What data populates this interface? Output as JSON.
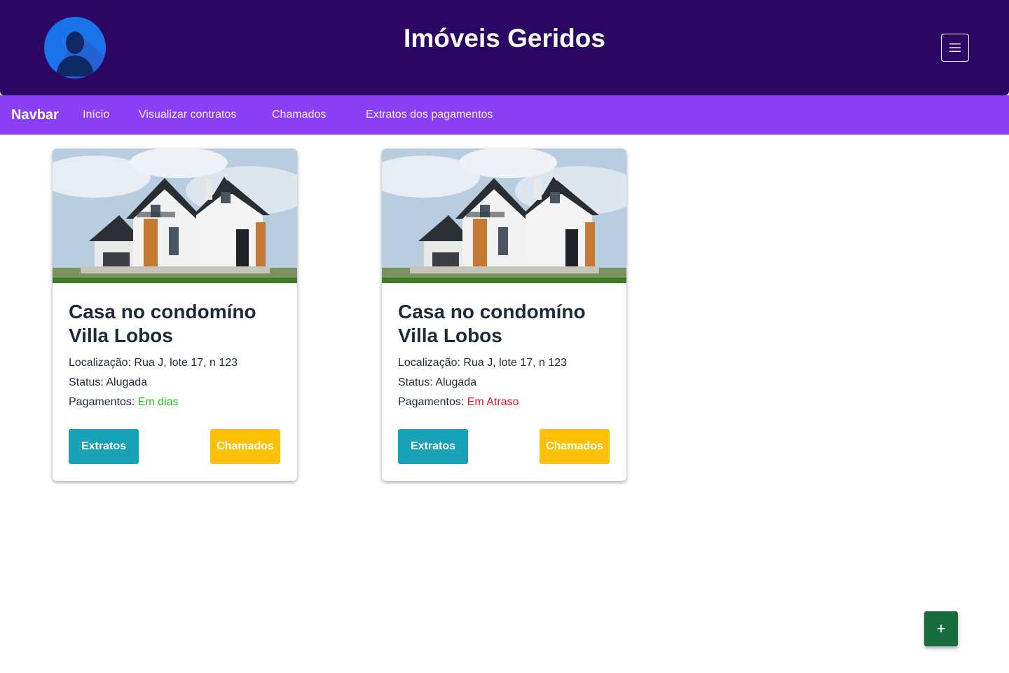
{
  "header": {
    "title": "Imóveis Geridos",
    "avatar_icon": "user-avatar-icon",
    "menu_icon": "hamburger-icon"
  },
  "navbar": {
    "brand": "Navbar",
    "links": [
      "Início",
      "Visualizar contratos",
      "Chamados",
      "Extratos dos pagamentos"
    ]
  },
  "cards": [
    {
      "title": "Casa no condomíno Villa Lobos",
      "location_label": "Localização:",
      "location": "Rua J, lote 17, n 123",
      "status_label": "Status:",
      "status": "Alugada",
      "payments_label": "Pagamentos:",
      "payments": "Em dias",
      "payments_color": "#22c41a",
      "btn_extratos": "Extratos",
      "btn_chamados": "Chamados"
    },
    {
      "title": "Casa no condomíno Villa Lobos",
      "location_label": "Localização:",
      "location": "Rua J, lote 17, n 123",
      "status_label": "Status:",
      "status": "Alugada",
      "payments_label": "Pagamentos:",
      "payments": "Em Atraso",
      "payments_color": "#e8141c",
      "btn_extratos": "Extratos",
      "btn_chamados": "Chamados"
    }
  ],
  "fab": {
    "label": "+"
  },
  "colors": {
    "header_bg": "#2b0763",
    "navbar_bg": "#8a3ff5",
    "info": "#17a2b8",
    "warning": "#ffc107",
    "fab": "#176b3d"
  }
}
